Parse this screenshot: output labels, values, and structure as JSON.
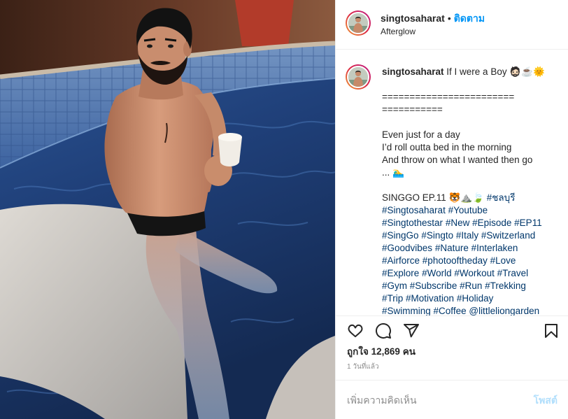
{
  "colors": {
    "text": "#262626",
    "muted": "#8e8e8e",
    "link": "#00376b",
    "follow": "#0095f6",
    "post_button": "#b2dffc",
    "border": "#efefef"
  },
  "icons": {
    "like": "heart-outline-icon",
    "comment": "comment-icon",
    "share": "paper-plane-icon",
    "save": "bookmark-outline-icon"
  },
  "post": {
    "header": {
      "username": "singtosaharat",
      "separator": "•",
      "follow_label": "ติดตาม",
      "location": "Afterglow"
    },
    "caption": {
      "username": "singtosaharat",
      "title": "If I were a Boy 🧔🏻☕🌞",
      "divider_lines": [
        "========================",
        "==========="
      ],
      "lyrics": [
        "Even just for a day",
        "I’d roll outta bed in the morning",
        "And throw on what I wanted then go",
        "... 🏊‍♂️"
      ],
      "episode": "SINGGO EP.11 🐯⛰️🍃",
      "episode_tag": "#ชลบุรี",
      "hashtag_lines": [
        [
          "#Singtosaharat",
          "#Youtube"
        ],
        [
          "#Singtothestar",
          "#New",
          "#Episode",
          "#EP11"
        ],
        [
          "#SingGo",
          "#Singto",
          "#Italy",
          "#Switzerland"
        ],
        [
          "#Goodvibes",
          "#Nature",
          "#Interlaken"
        ],
        [
          "#Airforce",
          "#photooftheday",
          "#Love"
        ],
        [
          "#Explore",
          "#World",
          "#Workout",
          "#Travel"
        ],
        [
          "#Gym",
          "#Subscribe",
          "#Run",
          "#Trekking"
        ],
        [
          "#Trip",
          "#Motivation",
          "#Holiday"
        ],
        [
          "#Swimming",
          "#Coffee",
          "@littleliongarden"
        ]
      ]
    },
    "likes": {
      "prefix": "ถูกใจ",
      "count": "12,869",
      "suffix": "คน"
    },
    "timestamp": "1 วันที่แล้ว",
    "comment_box": {
      "placeholder": "เพิ่มความคิดเห็น",
      "post_label": "โพสต์"
    }
  }
}
